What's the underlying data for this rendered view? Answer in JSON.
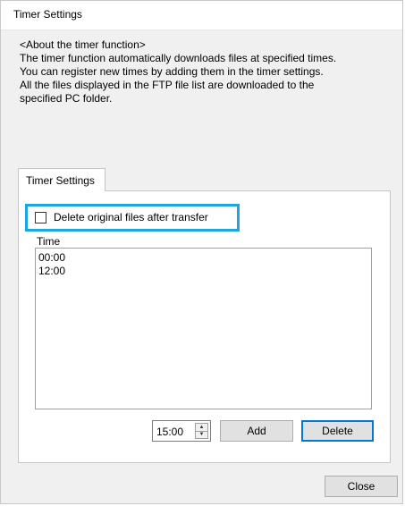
{
  "window": {
    "title": "Timer Settings"
  },
  "description": {
    "lines": [
      "<About the timer function>",
      "The timer function automatically downloads files at specified times.",
      "You can register new times by adding them in the timer settings.",
      "All the files displayed in the FTP file list are downloaded to the",
      "specified PC folder."
    ]
  },
  "tab": {
    "label": "Timer Settings"
  },
  "delete_option": {
    "label": "Delete original files after transfer",
    "checked": false,
    "highlight_color": "#1ea5e0"
  },
  "time_list": {
    "header": "Time",
    "items": [
      "00:00",
      "12:00"
    ]
  },
  "time_input": {
    "value": "15:00"
  },
  "buttons": {
    "add": "Add",
    "delete": "Delete",
    "close": "Close"
  },
  "colors": {
    "focus_border": "#0078d7",
    "dialog_bg": "#f0f0f0"
  }
}
